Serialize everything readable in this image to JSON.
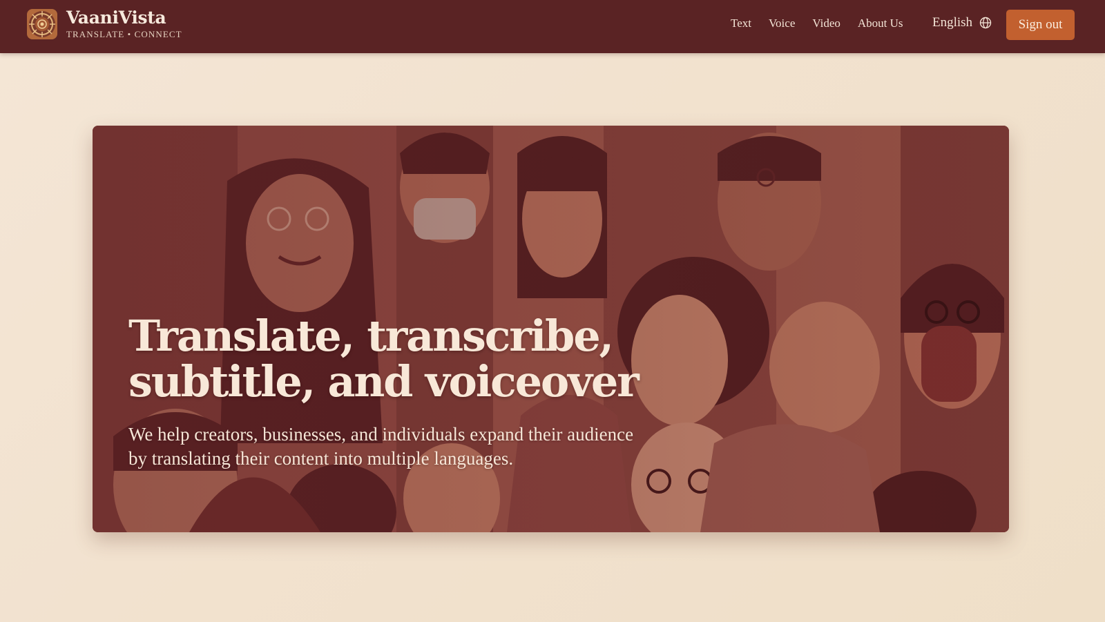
{
  "brand": {
    "name": "VaaniVista",
    "tagline": "TRANSLATE • CONNECT",
    "logo_icon": "mandala-logo-icon"
  },
  "nav": {
    "links": [
      {
        "label": "Text"
      },
      {
        "label": "Voice"
      },
      {
        "label": "Video"
      },
      {
        "label": "About Us"
      }
    ],
    "language": {
      "label": "English",
      "icon": "globe-icon"
    },
    "signout_label": "Sign out"
  },
  "hero": {
    "title": "Translate, transcribe, subtitle, and voiceover",
    "subtitle": "We help creators, businesses, and individuals expand their audience by translating their content into multiple languages."
  },
  "colors": {
    "nav_bg": "#5a2324",
    "accent": "#c2602f",
    "page_bg": "#f4e6d6",
    "hero_tone": "#8e4a40"
  }
}
